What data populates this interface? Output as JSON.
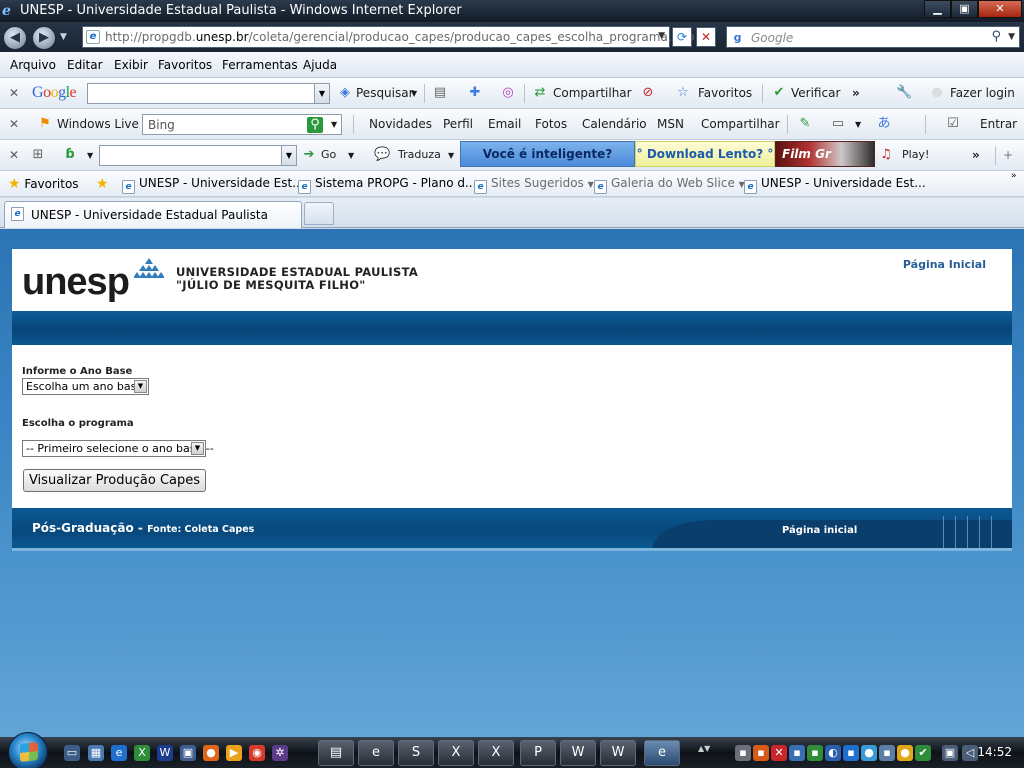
{
  "window": {
    "title": "UNESP - Universidade Estadual Paulista - Windows Internet Explorer"
  },
  "address_bar": {
    "url_prefix": "http://propgdb.",
    "url_domain": "unesp.br",
    "url_path": "/coleta/gerencial/producao_capes/producao_capes_escolha_programa.php",
    "search_placeholder": "Google"
  },
  "menu": [
    "Arquivo",
    "Editar",
    "Exibir",
    "Favoritos",
    "Ferramentas",
    "Ajuda"
  ],
  "google_toolbar": {
    "logo": "Google",
    "search_value": "",
    "pesquisar": "Pesquisar",
    "compartilhar": "Compartilhar",
    "favoritos": "Favoritos",
    "verificar": "Verificar",
    "fazer_login": "Fazer login"
  },
  "live_toolbar": {
    "windows_live": "Windows Live",
    "search_value": "Bing",
    "novidades": "Novidades",
    "perfil": "Perfil",
    "email": "Email",
    "fotos": "Fotos",
    "calendario": "Calendário",
    "msn": "MSN",
    "compartilhar": "Compartilhar",
    "entrar": "Entrar"
  },
  "third_toolbar": {
    "go": "Go",
    "traduza": "Traduza",
    "banner_1": "Você é inteligente?",
    "banner_2": "° Download Lento? °",
    "banner_3": "Film Gr",
    "play": "Play!"
  },
  "favorites_bar": {
    "favoritos": "Favoritos",
    "items": [
      "UNESP - Universidade Est...",
      "Sistema PROPG - Plano d...",
      "Sites Sugeridos",
      "Galeria do Web Slice",
      "UNESP - Universidade Est..."
    ]
  },
  "tab": {
    "title": "UNESP - Universidade Estadual Paulista"
  },
  "page": {
    "logo_text": "unesp",
    "university_line1": "UNIVERSIDADE ESTADUAL PAULISTA",
    "university_line2": "\"JÚLIO DE MESQUITA FILHO\"",
    "home_link": "Página Inicial",
    "ano_label": "Informe o Ano Base",
    "ano_select": "Escolha um ano base",
    "programa_label": "Escolha o programa",
    "programa_select": "-- Primeiro selecione o ano base --",
    "submit_button": "Visualizar Produção Capes",
    "footer_title": "Pós-Graduação - ",
    "footer_source": "Fonte: Coleta Capes",
    "footer_home": "Página inicial"
  },
  "taskbar": {
    "clock": "14:52"
  },
  "colors": {
    "header_band": "#074478",
    "link": "#295d95",
    "viewport_bg": "#3a86c4"
  }
}
